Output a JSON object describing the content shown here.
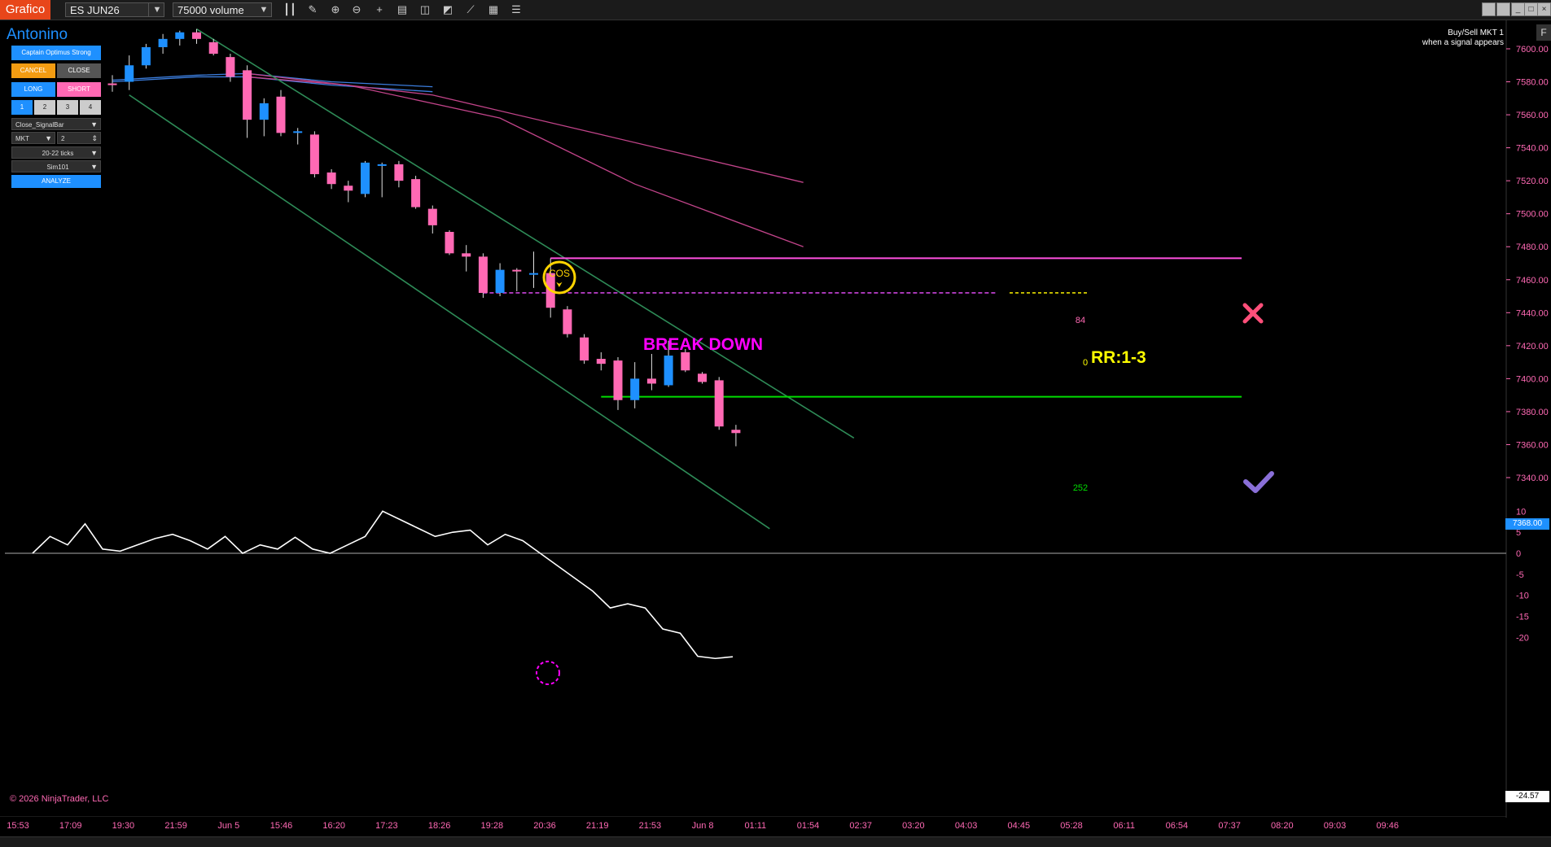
{
  "toolbar": {
    "tab_label": "Grafico",
    "instrument": "ES JUN26",
    "bar_type": "75000 volume"
  },
  "panel": {
    "title": "Antonino",
    "strategy_button": "Captain Optimus Strong",
    "cancel": "CANCEL",
    "close": "CLOSE",
    "long": "LONG",
    "short": "SHORT",
    "qty_buttons": [
      "1",
      "2",
      "3",
      "4"
    ],
    "exit_mode": "Close_SignalBar",
    "order_type": "MKT",
    "order_qty": "2",
    "stop_ticks": "20-22 ticks",
    "account": "Sim101",
    "analyze": "ANALYZE"
  },
  "signal_note": {
    "line1": "Buy/Sell MKT 1",
    "line2": "when a signal appears"
  },
  "annotations": {
    "cos_label": "COS",
    "breakdown": "BREAK DOWN",
    "rr": "RR:1-3",
    "stop_ticks": "84",
    "entry_ticks": "0",
    "target_ticks": "252"
  },
  "price_axis": {
    "labels": [
      "7600.00",
      "7580.00",
      "7560.00",
      "7540.00",
      "7520.00",
      "7500.00",
      "7480.00",
      "7460.00",
      "7440.00",
      "7420.00",
      "7400.00",
      "7380.00",
      "7360.00",
      "7340.00"
    ],
    "current_price": "7368.00"
  },
  "osc_axis": {
    "labels": [
      "10",
      "5",
      "0",
      "-5",
      "-10",
      "-15",
      "-20"
    ],
    "current_value": "-24.57"
  },
  "time_axis": {
    "labels": [
      "15:53",
      "17:09",
      "19:30",
      "21:59",
      "Jun 5",
      "15:46",
      "16:20",
      "17:23",
      "18:26",
      "19:28",
      "20:36",
      "21:19",
      "21:53",
      "Jun 8",
      "01:11",
      "01:54",
      "02:37",
      "03:20",
      "04:03",
      "04:45",
      "05:28",
      "06:11",
      "06:54",
      "07:37",
      "08:20",
      "09:03",
      "09:46"
    ]
  },
  "footer": {
    "copyright": "© 2026 NinjaTrader, LLC"
  },
  "colors": {
    "bull": "#1e90ff",
    "bear": "#ff69b4",
    "channel": "#2e8b57",
    "stop_line": "#ff00ff",
    "target_line": "#00dd00",
    "accent": "#e8461a"
  },
  "chart_data": {
    "type": "candlestick",
    "y_unit": "price",
    "candles": [
      {
        "t": 1,
        "o": 7579,
        "h": 7584,
        "l": 7574,
        "c": 7578
      },
      {
        "t": 2,
        "o": 7580,
        "h": 7596,
        "l": 7575,
        "c": 7590
      },
      {
        "t": 3,
        "o": 7590,
        "h": 7603,
        "l": 7588,
        "c": 7601
      },
      {
        "t": 4,
        "o": 7601,
        "h": 7609,
        "l": 7597,
        "c": 7606
      },
      {
        "t": 5,
        "o": 7606,
        "h": 7611,
        "l": 7602,
        "c": 7610
      },
      {
        "t": 6,
        "o": 7610,
        "h": 7612,
        "l": 7603,
        "c": 7606
      },
      {
        "t": 7,
        "o": 7604,
        "h": 7606,
        "l": 7596,
        "c": 7597
      },
      {
        "t": 8,
        "o": 7595,
        "h": 7597,
        "l": 7580,
        "c": 7583
      },
      {
        "t": 9,
        "o": 7587,
        "h": 7590,
        "l": 7546,
        "c": 7557
      },
      {
        "t": 10,
        "o": 7557,
        "h": 7570,
        "l": 7547,
        "c": 7567
      },
      {
        "t": 11,
        "o": 7571,
        "h": 7575,
        "l": 7547,
        "c": 7549
      },
      {
        "t": 12,
        "o": 7550,
        "h": 7552,
        "l": 7542,
        "c": 7550
      },
      {
        "t": 13,
        "o": 7548,
        "h": 7550,
        "l": 7522,
        "c": 7524
      },
      {
        "t": 14,
        "o": 7525,
        "h": 7527,
        "l": 7515,
        "c": 7518
      },
      {
        "t": 15,
        "o": 7517,
        "h": 7520,
        "l": 7507,
        "c": 7514
      },
      {
        "t": 16,
        "o": 7512,
        "h": 7532,
        "l": 7510,
        "c": 7531
      },
      {
        "t": 17,
        "o": 7530,
        "h": 7531,
        "l": 7510,
        "c": 7530
      },
      {
        "t": 18,
        "o": 7530,
        "h": 7532,
        "l": 7516,
        "c": 7520
      },
      {
        "t": 19,
        "o": 7521,
        "h": 7523,
        "l": 7503,
        "c": 7504
      },
      {
        "t": 20,
        "o": 7503,
        "h": 7505,
        "l": 7488,
        "c": 7493
      },
      {
        "t": 21,
        "o": 7489,
        "h": 7490,
        "l": 7475,
        "c": 7476
      },
      {
        "t": 22,
        "o": 7476,
        "h": 7481,
        "l": 7465,
        "c": 7474
      },
      {
        "t": 23,
        "o": 7474,
        "h": 7476,
        "l": 7449,
        "c": 7452
      },
      {
        "t": 24,
        "o": 7452,
        "h": 7470,
        "l": 7450,
        "c": 7466
      },
      {
        "t": 25,
        "o": 7466,
        "h": 7467,
        "l": 7453,
        "c": 7465
      },
      {
        "t": 26,
        "o": 7464,
        "h": 7477,
        "l": 7455,
        "c": 7464
      },
      {
        "t": 27,
        "o": 7464,
        "h": 7473,
        "l": 7437,
        "c": 7443
      },
      {
        "t": 28,
        "o": 7442,
        "h": 7444,
        "l": 7425,
        "c": 7427
      },
      {
        "t": 29,
        "o": 7425,
        "h": 7427,
        "l": 7409,
        "c": 7411
      },
      {
        "t": 30,
        "o": 7412,
        "h": 7416,
        "l": 7405,
        "c": 7409
      },
      {
        "t": 31,
        "o": 7411,
        "h": 7413,
        "l": 7381,
        "c": 7387
      },
      {
        "t": 32,
        "o": 7387,
        "h": 7410,
        "l": 7382,
        "c": 7400
      },
      {
        "t": 33,
        "o": 7400,
        "h": 7415,
        "l": 7393,
        "c": 7397
      },
      {
        "t": 34,
        "o": 7396,
        "h": 7423,
        "l": 7395,
        "c": 7414
      },
      {
        "t": 35,
        "o": 7416,
        "h": 7418,
        "l": 7404,
        "c": 7405
      },
      {
        "t": 36,
        "o": 7403,
        "h": 7404,
        "l": 7397,
        "c": 7398
      },
      {
        "t": 37,
        "o": 7399,
        "h": 7401,
        "l": 7369,
        "c": 7371
      },
      {
        "t": 38,
        "o": 7369,
        "h": 7372,
        "l": 7359,
        "c": 7367
      }
    ],
    "moving_averages": [
      {
        "name": "ma-blue-1",
        "points": [
          [
            1,
            7580
          ],
          [
            6,
            7583
          ],
          [
            9,
            7583
          ],
          [
            14,
            7578
          ],
          [
            20,
            7574
          ]
        ]
      },
      {
        "name": "ma-blue-2",
        "points": [
          [
            1,
            7581
          ],
          [
            6,
            7584
          ],
          [
            9,
            7585
          ],
          [
            14,
            7580
          ],
          [
            20,
            7577
          ]
        ]
      },
      {
        "name": "ma-pink-1",
        "points": [
          [
            9,
            7585
          ],
          [
            20,
            7572
          ],
          [
            30,
            7548
          ],
          [
            42,
            7519
          ]
        ]
      },
      {
        "name": "ma-pink-2",
        "points": [
          [
            9,
            7583
          ],
          [
            15,
            7578
          ],
          [
            24,
            7558
          ],
          [
            32,
            7518
          ],
          [
            42,
            7480
          ]
        ]
      }
    ],
    "channel": [
      {
        "name": "channel-upper",
        "from": [
          6,
          7612
        ],
        "to": [
          45,
          7364
        ]
      },
      {
        "name": "channel-lower",
        "from": [
          2,
          7572
        ],
        "to": [
          40,
          7309
        ]
      }
    ],
    "levels": {
      "stop": 7473,
      "entry": 7452,
      "target": 7389
    },
    "oscillator": {
      "name": "oscillator",
      "values": [
        0,
        4,
        2,
        7,
        1,
        0.5,
        2,
        3.5,
        4.5,
        3,
        1,
        4,
        0,
        2,
        1,
        3.8,
        1,
        0,
        2,
        4,
        10,
        8,
        6,
        4,
        5,
        5.5,
        2,
        4.5,
        3,
        0,
        -3,
        -6,
        -9,
        -13,
        -12,
        -13,
        -18,
        -19,
        -24.5,
        -25,
        -24.6
      ],
      "ylim": [
        -25,
        12
      ]
    }
  }
}
